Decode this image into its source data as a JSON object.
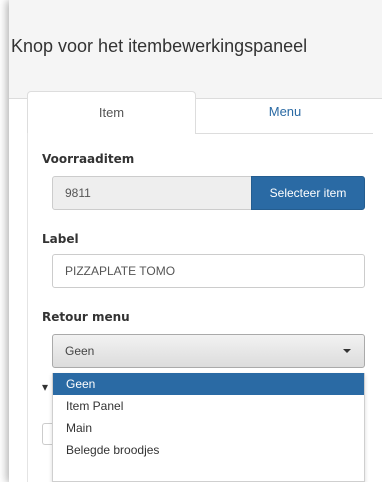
{
  "header": {
    "title": "Knop voor het itembewerkingspaneel"
  },
  "tabs": [
    {
      "label": "Item",
      "active": true
    },
    {
      "label": "Menu",
      "active": false
    }
  ],
  "form": {
    "stock_item": {
      "label": "Voorraaditem",
      "value": "9811",
      "button_label": "Selecteer item"
    },
    "label_field": {
      "label": "Label",
      "value": "PIZZAPLATE TOMO"
    },
    "return_menu": {
      "label": "Retour menu",
      "value": "Geen",
      "options": [
        "Geen",
        "Item Panel",
        "Main",
        "Belegde broodjes"
      ],
      "selected_index": 0
    }
  },
  "colors": {
    "accent": "#2a6aa4",
    "header_bg": "#f5f5f5",
    "readonly_bg": "#eeeeee"
  },
  "icons": {
    "dropdown": "caret-down-icon"
  }
}
